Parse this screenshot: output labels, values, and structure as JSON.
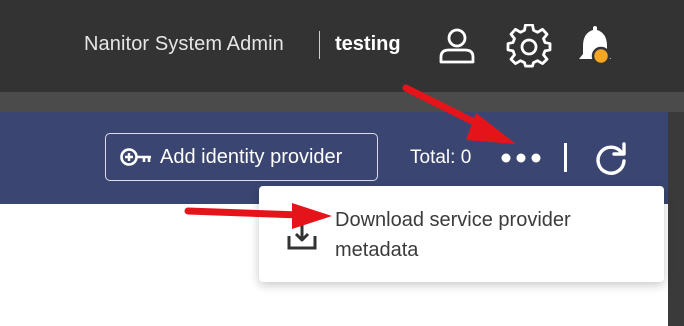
{
  "header": {
    "organization": "Nanitor System Admin",
    "tenant": "testing",
    "icons": [
      "user-icon",
      "gear-icon",
      "bell-icon"
    ],
    "notification_dot_color": "#f5a623"
  },
  "toolbar": {
    "add_button_label": "Add identity provider",
    "add_button_icon": "key-add-icon",
    "total_label": "Total: 0",
    "more_icon": "more-dots-icon",
    "refresh_icon": "refresh-icon"
  },
  "menu": {
    "items": [
      {
        "label": "Download service provider metadata",
        "icon": "download-icon"
      }
    ]
  },
  "annotations": {
    "arrow_color": "#e5141b"
  }
}
